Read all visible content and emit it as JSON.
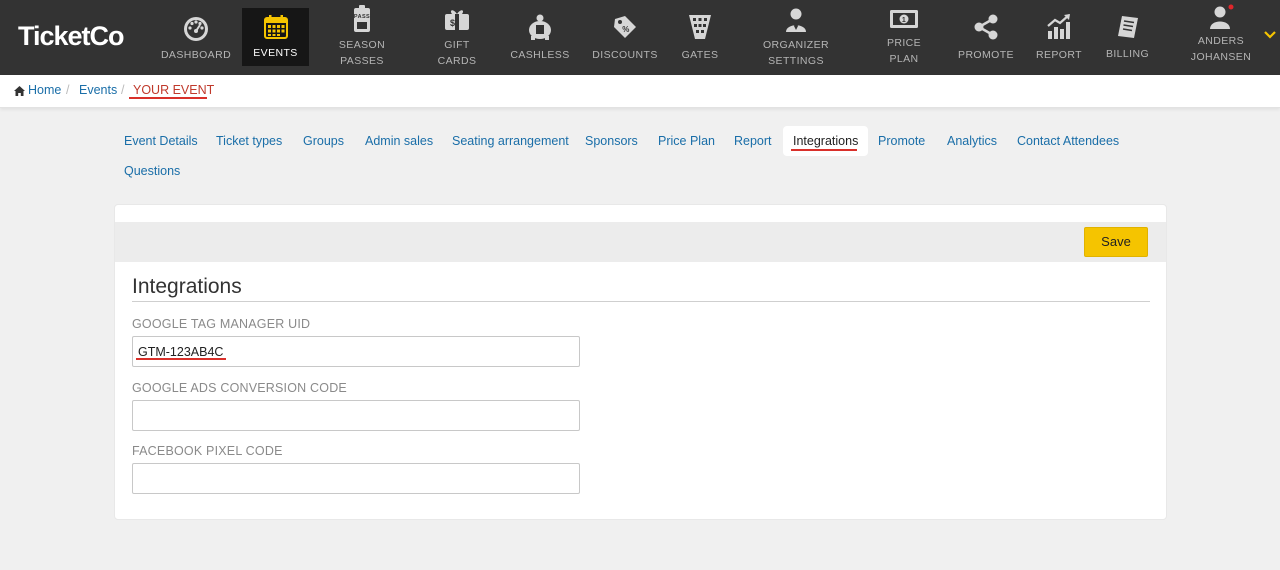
{
  "brand": {
    "logo": "TicketCo",
    "accent": "#f5c400",
    "underline_color": "#d9302a"
  },
  "nav": {
    "items": [
      {
        "line1": "DASHBOARD",
        "line2": "",
        "icon": "dashboard-gauge-icon"
      },
      {
        "line1": "EVENTS",
        "line2": "",
        "icon": "calendar-icon",
        "active": true
      },
      {
        "line1": "SEASON",
        "line2": "PASSES",
        "icon": "season-pass-icon"
      },
      {
        "line1": "GIFT",
        "line2": "CARDS",
        "icon": "gift-card-icon"
      },
      {
        "line1": "CASHLESS",
        "line2": "",
        "icon": "piggy-bank-icon"
      },
      {
        "line1": "DISCOUNTS",
        "line2": "",
        "icon": "discount-tag-icon"
      },
      {
        "line1": "GATES",
        "line2": "",
        "icon": "gate-icon"
      },
      {
        "line1": "ORGANIZER",
        "line2": "SETTINGS",
        "icon": "organizer-user-icon"
      },
      {
        "line1": "PRICE",
        "line2": "PLAN",
        "icon": "price-bill-icon"
      },
      {
        "line1": "PROMOTE",
        "line2": "",
        "icon": "share-icon"
      },
      {
        "line1": "REPORT",
        "line2": "",
        "icon": "report-chart-icon"
      },
      {
        "line1": "BILLING",
        "line2": "",
        "icon": "billing-receipt-icon"
      },
      {
        "line1": "ANDERS",
        "line2": "JOHANSEN",
        "icon": "user-avatar-icon"
      }
    ]
  },
  "breadcrumb": {
    "home": "Home",
    "sep": "/",
    "events": "Events",
    "current": "YOUR EVENT"
  },
  "tabs": [
    "Event Details",
    "Ticket types",
    "Groups",
    "Admin sales",
    "Seating arrangement",
    "Sponsors",
    "Price Plan",
    "Report",
    "Integrations",
    "Promote",
    "Analytics",
    "Contact Attendees",
    "Questions"
  ],
  "active_tab": "Integrations",
  "card": {
    "save_label": "Save",
    "title": "Integrations",
    "fields": [
      {
        "label": "GOOGLE TAG MANAGER UID",
        "value": "GTM-123AB4C",
        "placeholder": ""
      },
      {
        "label": "GOOGLE ADS CONVERSION CODE",
        "value": "",
        "placeholder": ""
      },
      {
        "label": "FACEBOOK PIXEL CODE",
        "value": "",
        "placeholder": ""
      }
    ]
  }
}
